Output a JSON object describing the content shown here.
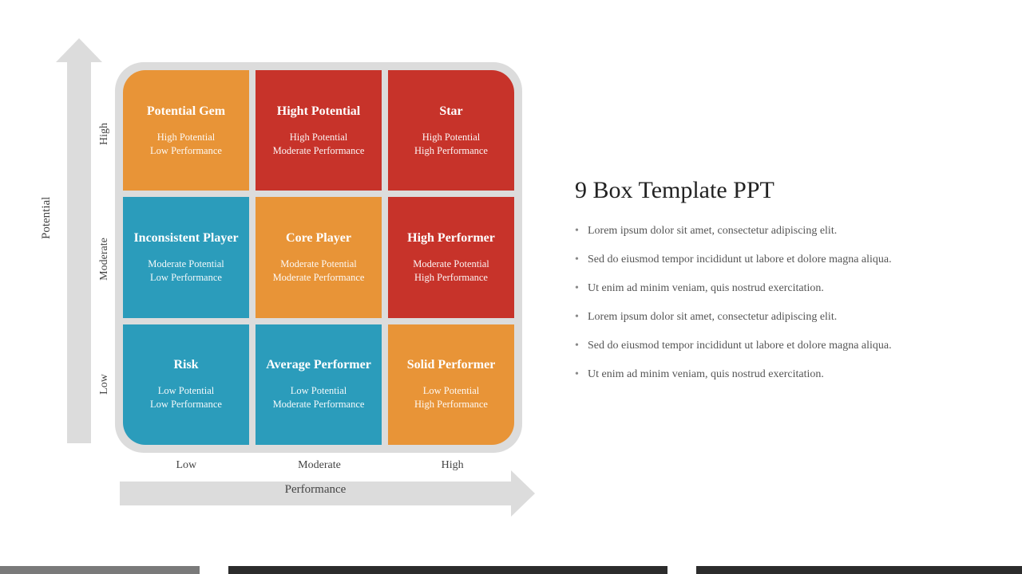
{
  "title": "9 Box Template PPT",
  "axes": {
    "y": {
      "label": "Potential",
      "ticks": [
        "High",
        "Moderate",
        "Low"
      ]
    },
    "x": {
      "label": "Performance",
      "ticks": [
        "Low",
        "Moderate",
        "High"
      ]
    }
  },
  "grid": [
    {
      "title": "Potential Gem",
      "line1": "High Potential",
      "line2": "Low Performance",
      "color": "orange"
    },
    {
      "title": "Hight Potential",
      "line1": "High Potential",
      "line2": "Moderate Performance",
      "color": "red"
    },
    {
      "title": "Star",
      "line1": "High Potential",
      "line2": "High Performance",
      "color": "red"
    },
    {
      "title": "Inconsistent Player",
      "line1": "Moderate Potential",
      "line2": "Low Performance",
      "color": "blue"
    },
    {
      "title": "Core Player",
      "line1": "Moderate Potential",
      "line2": "Moderate Performance",
      "color": "orange"
    },
    {
      "title": "High Performer",
      "line1": "Moderate Potential",
      "line2": "High Performance",
      "color": "red"
    },
    {
      "title": "Risk",
      "line1": "Low Potential",
      "line2": "Low Performance",
      "color": "blue"
    },
    {
      "title": "Average Performer",
      "line1": "Low Potential",
      "line2": "Moderate Performance",
      "color": "blue"
    },
    {
      "title": "Solid Performer",
      "line1": "Low Potential",
      "line2": "High Performance",
      "color": "orange"
    }
  ],
  "bullets": [
    "Lorem ipsum dolor sit amet, consectetur adipiscing elit.",
    "Sed do eiusmod tempor incididunt ut labore et dolore magna aliqua.",
    "Ut enim ad minim veniam, quis nostrud exercitation.",
    "Lorem ipsum dolor sit amet, consectetur adipiscing elit.",
    "Sed do eiusmod tempor incididunt ut labore et dolore magna aliqua.",
    "Ut enim ad minim veniam, quis nostrud exercitation."
  ]
}
